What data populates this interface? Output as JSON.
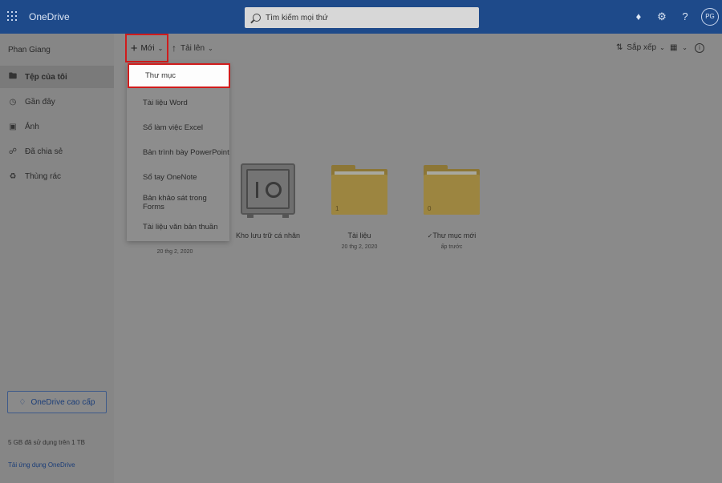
{
  "app": {
    "brand": "OneDrive"
  },
  "search": {
    "placeholder": "Tìm kiếm mọi thứ"
  },
  "user": {
    "name": "Phan Giang",
    "initials": "PG"
  },
  "sidebar": {
    "items": [
      {
        "label": "Tệp của tôi",
        "icon": "folder-icon",
        "active": true
      },
      {
        "label": "Gần đây",
        "icon": "clock-icon"
      },
      {
        "label": "Ảnh",
        "icon": "photo-icon"
      },
      {
        "label": "Đã chia sẻ",
        "icon": "share-icon"
      },
      {
        "label": "Thùng rác",
        "icon": "recycle-bin-icon"
      }
    ],
    "premium_label": "OneDrive cao cấp",
    "storage_text": "5 GB đã sử dụng trên 1 TB",
    "get_apps": "Tải ứng dụng OneDrive"
  },
  "commandbar": {
    "new_label": "Mới",
    "upload_label": "Tải lên",
    "sort_label": "Sắp xếp"
  },
  "new_menu": {
    "items": [
      "Thư mục",
      "Tài liệu Word",
      "Sổ làm việc Excel",
      "Bản trình bày PowerPoint",
      "Sổ tay OneNote",
      "Bản khảo sát trong Forms",
      "Tài liệu văn bản thuần"
    ]
  },
  "tiles": [
    {
      "name": "",
      "date": "20 thg 2, 2020"
    },
    {
      "name": "Kho lưu trữ cá nhân",
      "date": ""
    },
    {
      "name": "Tài liệu",
      "date": "20 thg 2, 2020",
      "count": "1"
    },
    {
      "name": "Thư mục mới",
      "date": "ấp trước",
      "count": "0"
    }
  ],
  "colors": {
    "topbar": "#1e4a8a",
    "highlight_border": "#d01c1c",
    "folder": "#9c8540"
  }
}
